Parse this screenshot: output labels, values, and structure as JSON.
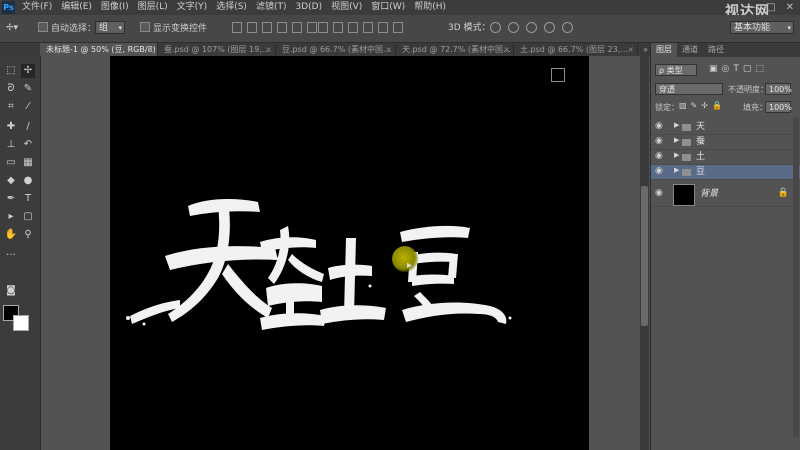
{
  "app": {
    "logo": "Ps",
    "watermark": "视达网"
  },
  "menu": [
    "文件(F)",
    "编辑(E)",
    "图像(I)",
    "图层(L)",
    "文字(Y)",
    "选择(S)",
    "滤镜(T)",
    "3D(D)",
    "视图(V)",
    "窗口(W)",
    "帮助(H)"
  ],
  "window_controls": [
    "–",
    "□",
    "✕"
  ],
  "options": {
    "auto_select": "自动选择：",
    "auto_select_value": "组",
    "show_transform": "显示变换控件",
    "mode_3d": "3D 模式：",
    "workspace": "基本功能"
  },
  "tabs": [
    {
      "label": "未标题-1 @ 50% (豆, RGB/8) *",
      "active": true
    },
    {
      "label": "蚕.psd @ 107% (图层 19,...",
      "active": false
    },
    {
      "label": "豆.psd @ 66.7% (素材中国...",
      "active": false
    },
    {
      "label": "天.psd @ 72.7% (素材中国...",
      "active": false
    },
    {
      "label": "土.psd @ 66.7% (图层 23,...",
      "active": false
    }
  ],
  "layers_panel": {
    "tabs": [
      "图层",
      "通道",
      "路径"
    ],
    "filter_kind": "ρ 类型",
    "blend_mode": "穿透",
    "opacity_label": "不透明度：",
    "opacity_value": "100%",
    "lock_label": "锁定：",
    "fill_label": "填充：",
    "fill_value": "100%",
    "groups": [
      {
        "name": "天",
        "selected": false
      },
      {
        "name": "蚕",
        "selected": false
      },
      {
        "name": "土",
        "selected": false
      },
      {
        "name": "豆",
        "selected": true
      }
    ],
    "background_layer": "背景"
  },
  "canvas": {
    "background": "#000000",
    "artwork": [
      "天",
      "蚕",
      "土",
      "豆"
    ]
  },
  "colors": {
    "foreground": "#000000",
    "background": "#ffffff",
    "selection": "#596b88"
  }
}
